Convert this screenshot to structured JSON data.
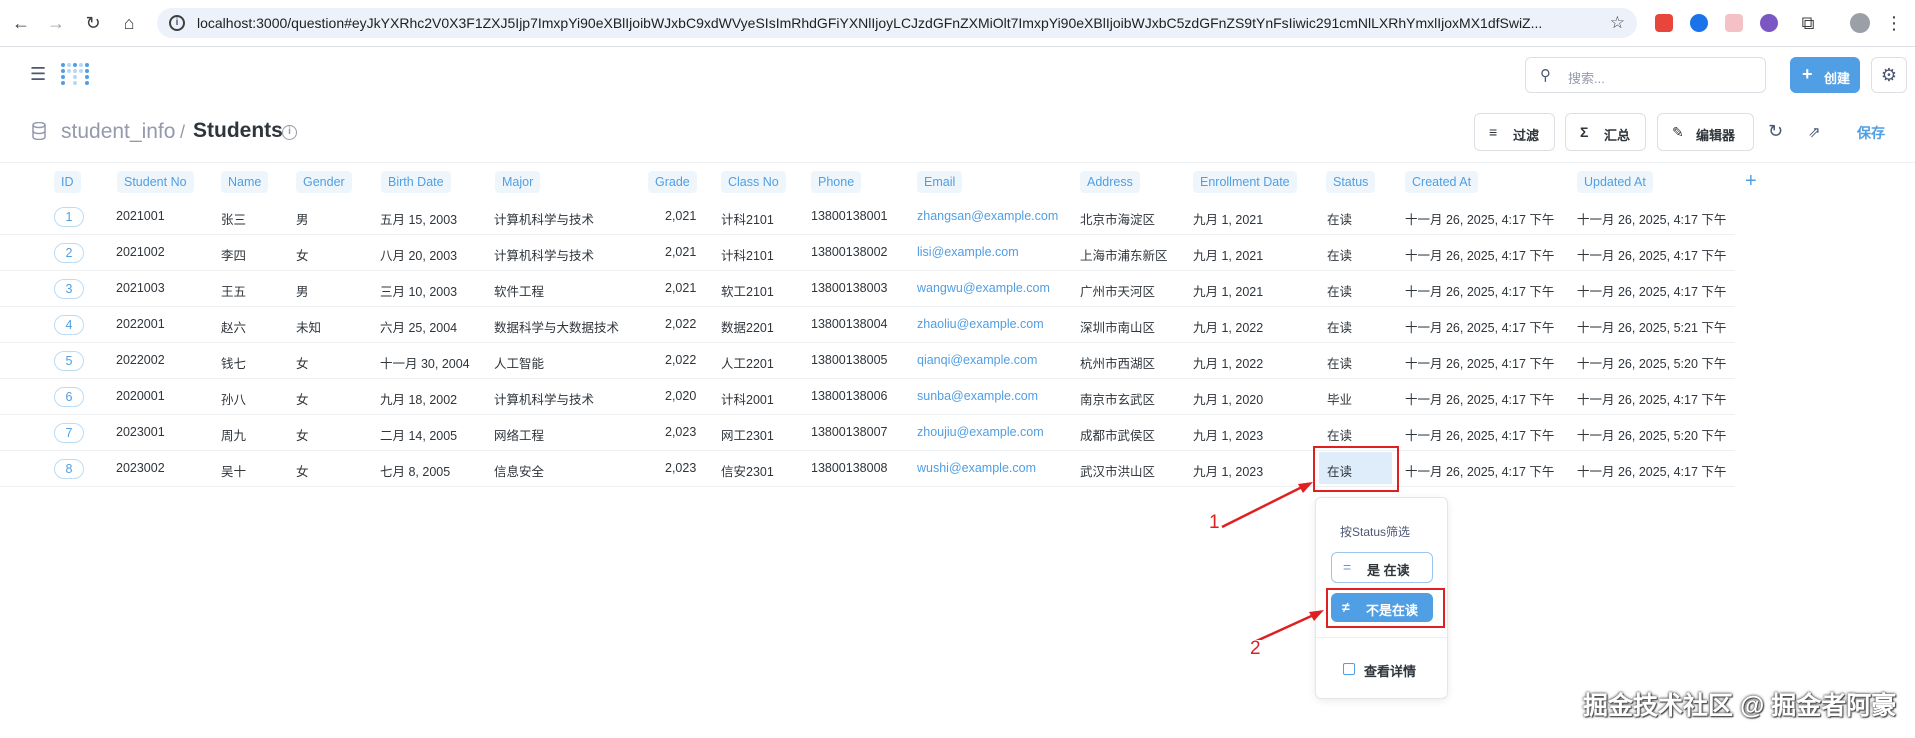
{
  "browser": {
    "url": "localhost:3000/question#eyJkYXRhc2V0X3F1ZXJ5Ijp7ImxpYi90eXBlIjoibWJxbC9xdWVyeSIsImRhdGFiYXNlIjoyLCJzdGFnZXMiOlt7ImxpYi90eXBlIjoibWJxbC5zdGFnZS9tYnFsIiwic291cmNlLXRhYmxlIjoxMX1dfSwiZ...",
    "icons": [
      "back-arrow-icon",
      "forward-arrow-icon",
      "reload-icon",
      "home-icon",
      "site-info-icon",
      "bookmark-star-icon",
      "extensions-icon",
      "profile-icon"
    ]
  },
  "header": {
    "search_placeholder": "搜索...",
    "create_label": "创建"
  },
  "titlebar": {
    "database": "student_info",
    "separator": "/",
    "table": "Students",
    "filter_label": "过滤",
    "summarize_label": "汇总",
    "editor_label": "编辑器",
    "save_label": "保存"
  },
  "table": {
    "columns": [
      "ID",
      "Student No",
      "Name",
      "Gender",
      "Birth Date",
      "Major",
      "Grade",
      "Class No",
      "Phone",
      "Email",
      "Address",
      "Enrollment Date",
      "Status",
      "Created At",
      "Updated At"
    ],
    "rows": [
      {
        "id": "1",
        "student_no": "2021001",
        "name": "张三",
        "gender": "男",
        "birth": "五月 15, 2003",
        "major": "计算机科学与技术",
        "grade": "2,021",
        "class_no": "计科2101",
        "phone": "13800138001",
        "email": "zhangsan@example.com",
        "address": "北京市海淀区",
        "enroll": "九月 1, 2021",
        "status": "在读",
        "created": "十一月 26, 2025, 4:17 下午",
        "updated": "十一月 26, 2025, 4:17 下午"
      },
      {
        "id": "2",
        "student_no": "2021002",
        "name": "李四",
        "gender": "女",
        "birth": "八月 20, 2003",
        "major": "计算机科学与技术",
        "grade": "2,021",
        "class_no": "计科2101",
        "phone": "13800138002",
        "email": "lisi@example.com",
        "address": "上海市浦东新区",
        "enroll": "九月 1, 2021",
        "status": "在读",
        "created": "十一月 26, 2025, 4:17 下午",
        "updated": "十一月 26, 2025, 4:17 下午"
      },
      {
        "id": "3",
        "student_no": "2021003",
        "name": "王五",
        "gender": "男",
        "birth": "三月 10, 2003",
        "major": "软件工程",
        "grade": "2,021",
        "class_no": "软工2101",
        "phone": "13800138003",
        "email": "wangwu@example.com",
        "address": "广州市天河区",
        "enroll": "九月 1, 2021",
        "status": "在读",
        "created": "十一月 26, 2025, 4:17 下午",
        "updated": "十一月 26, 2025, 4:17 下午"
      },
      {
        "id": "4",
        "student_no": "2022001",
        "name": "赵六",
        "gender": "未知",
        "birth": "六月 25, 2004",
        "major": "数据科学与大数据技术",
        "grade": "2,022",
        "class_no": "数据2201",
        "phone": "13800138004",
        "email": "zhaoliu@example.com",
        "address": "深圳市南山区",
        "enroll": "九月 1, 2022",
        "status": "在读",
        "created": "十一月 26, 2025, 4:17 下午",
        "updated": "十一月 26, 2025, 5:21 下午"
      },
      {
        "id": "5",
        "student_no": "2022002",
        "name": "钱七",
        "gender": "女",
        "birth": "十一月 30, 2004",
        "major": "人工智能",
        "grade": "2,022",
        "class_no": "人工2201",
        "phone": "13800138005",
        "email": "qianqi@example.com",
        "address": "杭州市西湖区",
        "enroll": "九月 1, 2022",
        "status": "在读",
        "created": "十一月 26, 2025, 4:17 下午",
        "updated": "十一月 26, 2025, 5:20 下午"
      },
      {
        "id": "6",
        "student_no": "2020001",
        "name": "孙八",
        "gender": "女",
        "birth": "九月 18, 2002",
        "major": "计算机科学与技术",
        "grade": "2,020",
        "class_no": "计科2001",
        "phone": "13800138006",
        "email": "sunba@example.com",
        "address": "南京市玄武区",
        "enroll": "九月 1, 2020",
        "status": "毕业",
        "created": "十一月 26, 2025, 4:17 下午",
        "updated": "十一月 26, 2025, 4:17 下午"
      },
      {
        "id": "7",
        "student_no": "2023001",
        "name": "周九",
        "gender": "女",
        "birth": "二月 14, 2005",
        "major": "网络工程",
        "grade": "2,023",
        "class_no": "网工2301",
        "phone": "13800138007",
        "email": "zhoujiu@example.com",
        "address": "成都市武侯区",
        "enroll": "九月 1, 2023",
        "status": "在读",
        "created": "十一月 26, 2025, 4:17 下午",
        "updated": "十一月 26, 2025, 5:20 下午"
      },
      {
        "id": "8",
        "student_no": "2023002",
        "name": "吴十",
        "gender": "女",
        "birth": "七月 8, 2005",
        "major": "信息安全",
        "grade": "2,023",
        "class_no": "信安2301",
        "phone": "13800138008",
        "email": "wushi@example.com",
        "address": "武汉市洪山区",
        "enroll": "九月 1, 2023",
        "status": "在读",
        "created": "十一月 26, 2025, 4:17 下午",
        "updated": "十一月 26, 2025, 4:17 下午"
      }
    ]
  },
  "popover": {
    "title": "按Status筛选",
    "equals_icon": "=",
    "equals_label": "是 在读",
    "not_equals_icon": "≠",
    "not_equals_label": "不是在读",
    "detail_label": "查看详情"
  },
  "annotations": {
    "step1": "1",
    "step2": "2",
    "color": "#e02020"
  },
  "watermark": "掘金技术社区 @ 掘金者阿豪",
  "colors": {
    "accent": "#509ee3",
    "text_dark": "#2e353b",
    "text_muted": "#949aab"
  }
}
